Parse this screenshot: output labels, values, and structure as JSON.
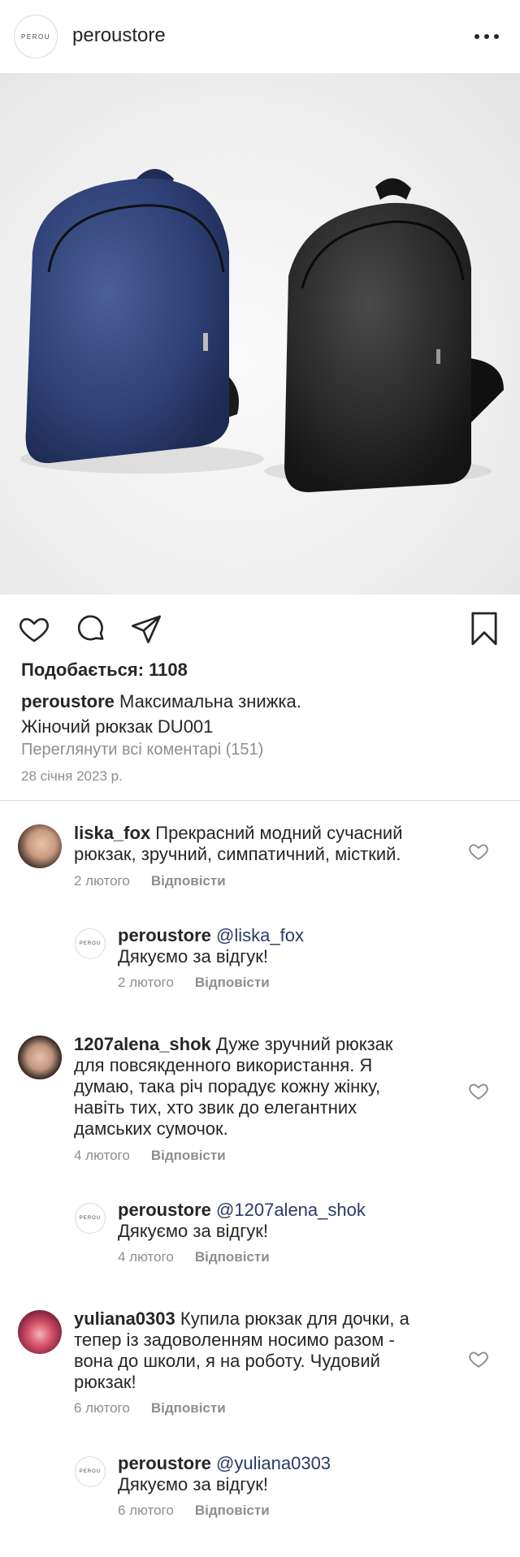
{
  "header": {
    "logo_text": "PEROU",
    "username": "peroustore",
    "more_icon": "more-horizontal-icon"
  },
  "post": {
    "image_alt": "",
    "likes": "Подобається: 1108",
    "caption_user": "peroustore",
    "caption_line1": "Максимальна знижка.",
    "caption_line2": "Жіночий рюкзак DU001",
    "view_all": "Переглянути всі коментарі (151)",
    "date": "28 січня 2023 р."
  },
  "comments": [
    {
      "user": "liska_fox",
      "text_lines": [
        "Прекрасний модний сучасний",
        "рюкзак, зручний, симпатичний, місткий."
      ],
      "date": "2 лютого",
      "reply_label": "Відповісти"
    },
    {
      "user": "peroustore",
      "mention": "@liska_fox",
      "text": "Дякуємо за відгук!",
      "date": "2 лютого",
      "reply_label": "Відповісти"
    },
    {
      "user": "1207alena_shok",
      "text_lines": [
        "Дуже зручний рюкзак",
        "для повсякденного використання. Я",
        "думаю, така річ порадує кожну жінку,",
        "навіть тих, хто звик до елегантних",
        "дамських сумочок."
      ],
      "date": "4 лютого",
      "reply_label": "Відповісти"
    },
    {
      "user": "peroustore",
      "mention": "@1207alena_shok",
      "text": "Дякуємо за відгук!",
      "date": "4 лютого",
      "reply_label": "Відповісти"
    },
    {
      "user": "yuliana0303",
      "text_lines": [
        "Купила рюкзак для дочки, а",
        "тепер із задоволенням носимо разом -",
        "вона до школи, я на роботу. Чудовий",
        "рюкзак!"
      ],
      "date": "6 лютого",
      "reply_label": "Відповісти"
    },
    {
      "user": "peroustore",
      "mention": "@yuliana0303",
      "text": "Дякуємо за відгук!",
      "date": "6 лютого",
      "reply_label": "Відповісти"
    }
  ],
  "colors": {
    "text": "#262626",
    "muted": "#8e8e8e",
    "mention": "#2b3a67",
    "divider": "#dbdbdb",
    "bag_blue": "#2c3f73",
    "bag_black": "#232323"
  }
}
